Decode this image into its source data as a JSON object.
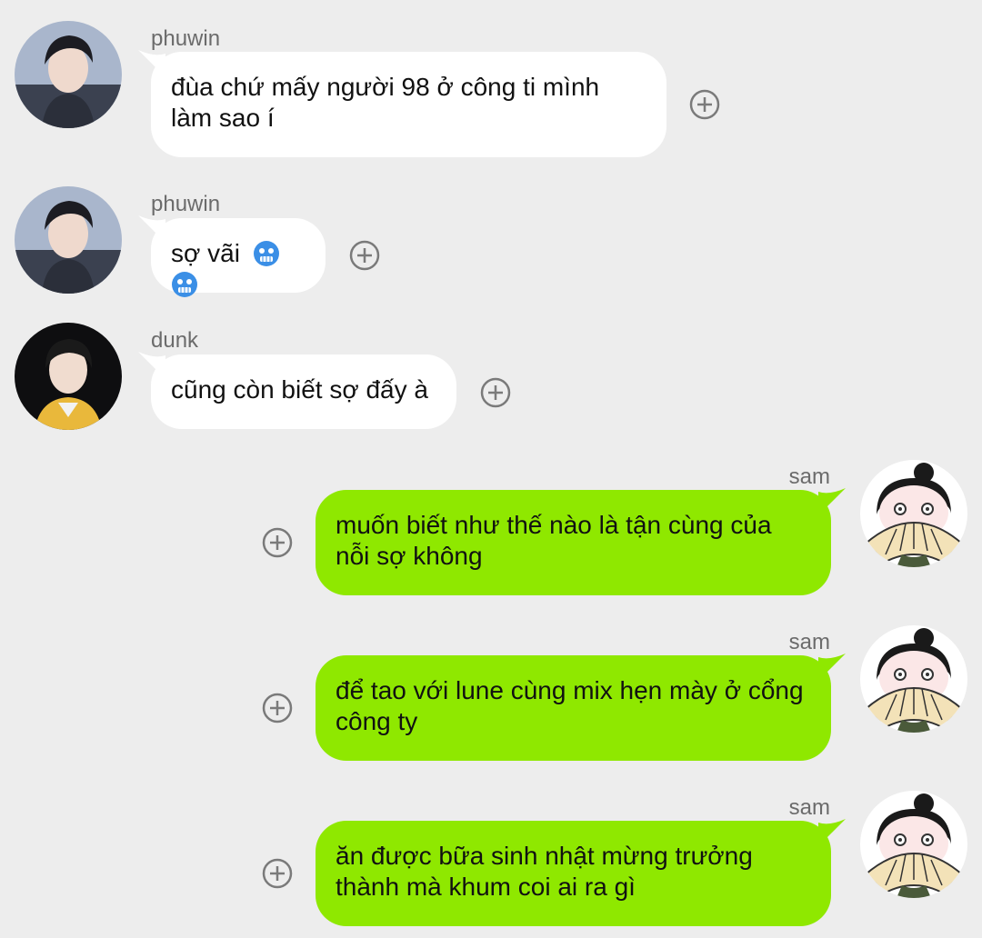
{
  "messages": [
    {
      "sender": "phuwin",
      "text": "đùa chứ mấy người 98 ở công ti mình làm sao í"
    },
    {
      "sender": "phuwin",
      "text": "sợ vãi",
      "emoji": [
        "cold-face-emoji",
        "cold-face-emoji"
      ]
    },
    {
      "sender": "dunk",
      "text": "cũng còn biết sợ đấy à"
    },
    {
      "sender": "sam",
      "text": "muốn biết như thế nào là tận cùng của nỗi sợ không"
    },
    {
      "sender": "sam",
      "text": "để tao với lune cùng mix hẹn mày ở cổng công ty"
    },
    {
      "sender": "sam",
      "text": "ăn được bữa sinh nhật mừng trưởng thành mà khum coi ai ra gì"
    }
  ],
  "colors": {
    "background": "#ededed",
    "incoming_bubble": "#ffffff",
    "outgoing_bubble": "#8fe800",
    "plus_icon": "#7a7a7a"
  }
}
